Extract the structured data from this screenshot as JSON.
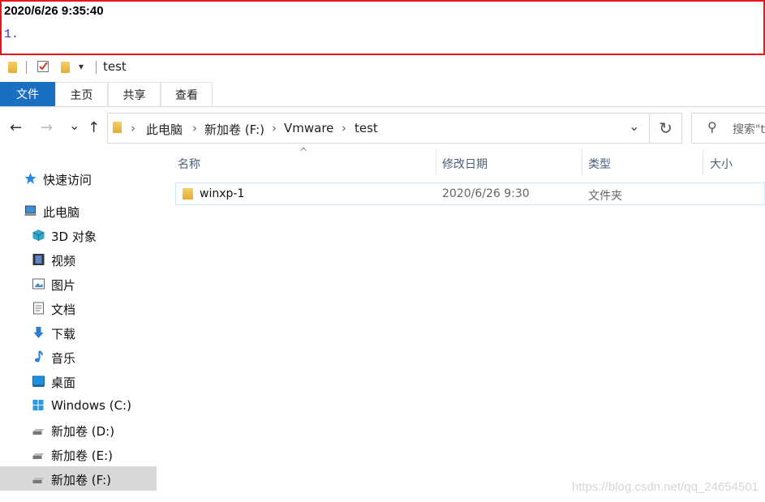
{
  "annotation": {
    "timestamp": "2020/6/26 9:35:40",
    "note": "1."
  },
  "qat": {
    "dropdown_glyph": "▾",
    "title": "test"
  },
  "ribbon": {
    "tabs": [
      {
        "label": "文件"
      },
      {
        "label": "主页"
      },
      {
        "label": "共享"
      },
      {
        "label": "查看"
      }
    ],
    "accent": "#1a6fc1"
  },
  "address": {
    "crumbs": [
      "此电脑",
      "新加卷 (F:)",
      "Vmware",
      "test"
    ],
    "search_placeholder": "搜索\"t"
  },
  "nav": {
    "back": "←",
    "forward": "→",
    "recent": "⌄",
    "up": "↑",
    "refresh": "↻",
    "dropdown": "⌄",
    "search_icon": "⚲"
  },
  "sidebar": {
    "items": [
      {
        "label": "快速访问",
        "icon": "star-icon"
      },
      {
        "label": "此电脑",
        "icon": "computer-icon"
      },
      {
        "label": "3D 对象",
        "icon": "cube-icon"
      },
      {
        "label": "视频",
        "icon": "video-icon"
      },
      {
        "label": "图片",
        "icon": "pictures-icon"
      },
      {
        "label": "文档",
        "icon": "document-icon"
      },
      {
        "label": "下载",
        "icon": "download-icon"
      },
      {
        "label": "音乐",
        "icon": "music-icon"
      },
      {
        "label": "桌面",
        "icon": "desktop-icon"
      },
      {
        "label": "Windows (C:)",
        "icon": "windows-drive-icon"
      },
      {
        "label": "新加卷 (D:)",
        "icon": "drive-icon"
      },
      {
        "label": "新加卷 (E:)",
        "icon": "drive-icon"
      },
      {
        "label": "新加卷 (F:)",
        "icon": "drive-icon",
        "selected": true
      }
    ]
  },
  "columns": {
    "name": "名称",
    "modified": "修改日期",
    "type": "类型",
    "size": "大小",
    "sort_glyph": "^"
  },
  "files": [
    {
      "name": "winxp-1",
      "modified": "2020/6/26 9:30",
      "type": "文件夹",
      "size": ""
    }
  ],
  "watermark": "https://blog.csdn.net/qq_24654501"
}
